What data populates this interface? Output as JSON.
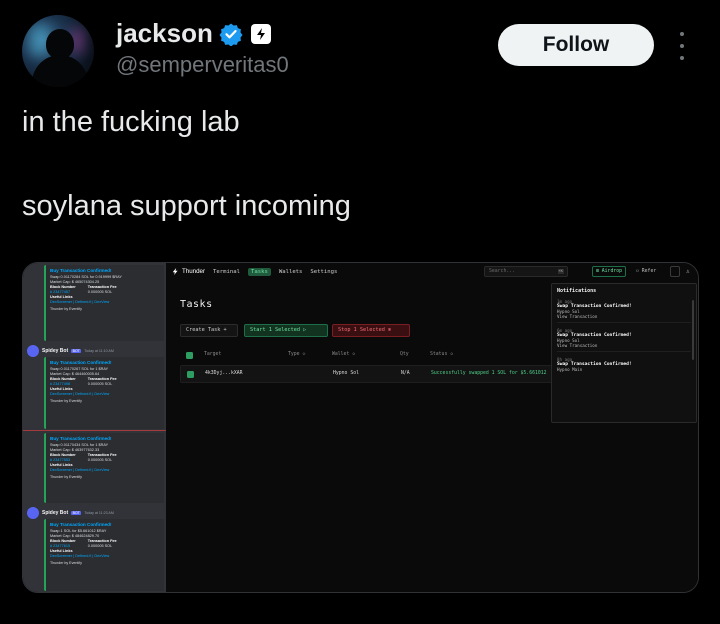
{
  "user": {
    "display_name": "jackson",
    "handle": "@semperveritas0"
  },
  "actions": {
    "follow_label": "Follow"
  },
  "tweet": {
    "line1": "in the fucking lab",
    "line2": "soylana support incoming"
  },
  "colors": {
    "verified": "#1d9bf0",
    "accent_green": "#6fe3a4",
    "stop_red": "#f26d74"
  },
  "discord": {
    "embeds": [
      {
        "title": "Buy Transaction Confirmed!",
        "lines": [
          "Swap 0.01170284 SOL for 0.919999 $RAY",
          "Market Cap: $ 465074304.25"
        ],
        "block_label": "Block Number",
        "block_value": "# 23477457",
        "fee_label": "Transaction Fee",
        "fee_value": "0.000005 SOL",
        "links_label": "Useful Links",
        "links": "DexScreener | Defined.fi | DexView",
        "footer": "Thunder by Eventify"
      },
      {
        "title": "Buy Transaction Confirmed!",
        "lines": [
          "Swap 0.01170267 SOL for 1 $RAY",
          "Market Cap: $ 464460005.64"
        ],
        "block_label": "Block Number",
        "block_value": "# 23477498",
        "fee_label": "Transaction Fee",
        "fee_value": "0.000005 SOL",
        "links_label": "Useful Links",
        "links": "DexScreener | Defined.fi | DexView",
        "footer": "Thunder by Eventify"
      },
      {
        "title": "Buy Transaction Confirmed!",
        "lines": [
          "Swap 0.01170434 SOL for 1 $RAY",
          "Market Cap: $ 463977632.33"
        ],
        "block_label": "Block Number",
        "block_value": "# 23477553",
        "fee_label": "Transaction Fee",
        "fee_value": "0.000005 SOL",
        "links_label": "Useful Links",
        "links": "DexScreener | Defined.fi | DexView",
        "footer": "Thunder by Eventify"
      },
      {
        "title": "Buy Transaction Confirmed!",
        "lines": [
          "Swap 1 SOL for $5.661012 $RAY",
          "Market Cap: $ 484624829.70"
        ],
        "block_label": "Block Number",
        "block_value": "# 23477615",
        "fee_label": "Transaction Fee",
        "fee_value": "0.000005 SOL",
        "links_label": "Useful Links",
        "links": "DexScreener | Defined.fi | DexView",
        "footer": "Thunder by Eventify"
      }
    ],
    "bot_name": "Spidey Bot",
    "bot_tag": "BOT",
    "bot_time_1": "Today at 11:10 AM",
    "bot_time_2": "Today at 11:23 AM"
  },
  "app": {
    "brand": "Thunder",
    "nav": [
      "Terminal",
      "Tasks",
      "Wallets",
      "Settings"
    ],
    "search_placeholder": "Search...",
    "search_kbd": "⌘K",
    "airdrop_label": "Airdrop",
    "refer_label": "Refer",
    "page_title": "Tasks",
    "buttons": {
      "create": "Create Task +",
      "start": "Start 1 Selected ▷",
      "stop": "Stop 1 Selected ⊗"
    },
    "table": {
      "headers": [
        "Target",
        "Type ◇",
        "Wallet ◇",
        "Qty",
        "Status ◇"
      ],
      "row": {
        "target": "4k3Dyj...kXAR",
        "type": "",
        "wallet": "Hypno Sol",
        "qty": "N/A",
        "status": "Successfully swapped 1 SOL for $5.661012"
      }
    },
    "notifications": {
      "title": "Notifications",
      "items": [
        {
          "time": "1m ago",
          "title": "Swap Transaction Confirmed!",
          "wallet": "Hypno Sol",
          "link": "View Transaction"
        },
        {
          "time": "6m ago",
          "title": "Swap Transaction Confirmed!",
          "wallet": "Hypno Sol",
          "link": "View Transaction"
        },
        {
          "time": "8h ago",
          "title": "Swap Transaction Confirmed!",
          "wallet": "Hypno Main",
          "link": ""
        }
      ]
    }
  }
}
